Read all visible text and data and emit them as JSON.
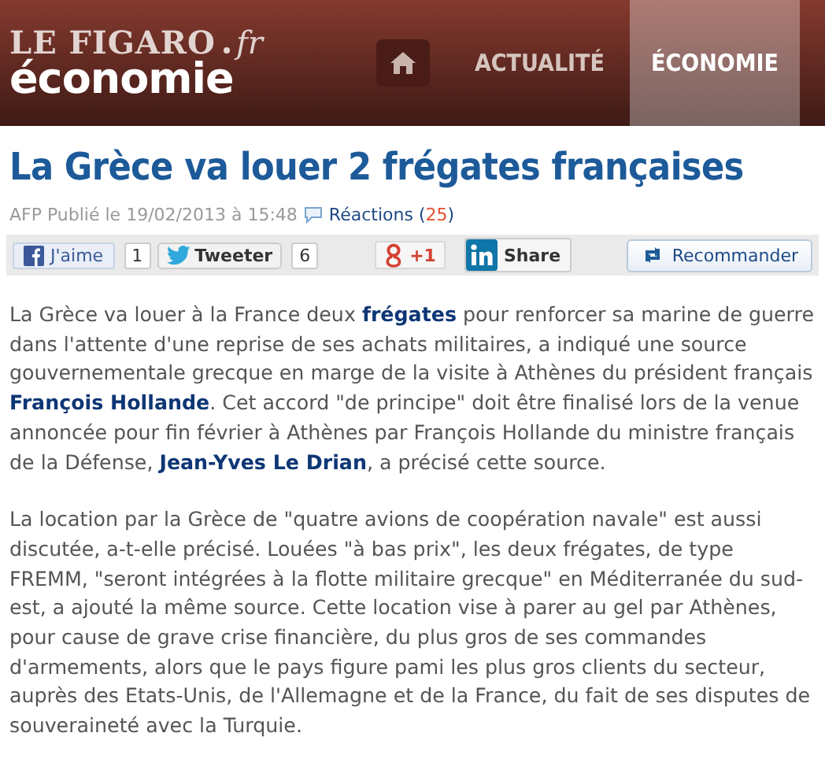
{
  "header": {
    "logo": {
      "brand": "LE FIGARO",
      "suffix": "fr",
      "section": "économie"
    },
    "nav": [
      {
        "kind": "home",
        "selected": false
      },
      {
        "kind": "text",
        "label": "ACTUALITÉ",
        "selected": false
      },
      {
        "kind": "text",
        "label": "ÉCONOMIE",
        "selected": true
      }
    ]
  },
  "article": {
    "title": "La Grèce va louer 2 frégates françaises",
    "meta": {
      "byline": "AFP Publié le 19/02/2013 à 15:48",
      "reactions_label": "Réactions",
      "reactions_open": "(",
      "reactions_count": "25",
      "reactions_close": ")"
    },
    "share": [
      {
        "kind": "facebook",
        "label": "J'aime",
        "count": "1"
      },
      {
        "kind": "twitter",
        "label": "Tweeter",
        "count": "6"
      },
      {
        "kind": "google",
        "label": "+1"
      },
      {
        "kind": "linkedin",
        "label": "Share"
      },
      {
        "kind": "recommend",
        "label": "Recommander"
      }
    ],
    "paragraphs": [
      "La Grèce va louer à la France deux **frégates** pour renforcer sa marine de guerre dans l'attente d'une reprise de ses achats militaires, a indiqué une source gouvernementale grecque en marge de la visite à Athènes du président français **François Hollande**.  Cet accord \"de principe\" doit être finalisé lors de la venue annoncée pour fin février à Athènes par François Hollande du ministre français de la Défense, **Jean-Yves Le Drian**, a précisé cette source.",
      "La location par la Grèce de \"quatre avions de coopération navale\" est aussi discutée, a-t-elle précisé.  Louées \"à bas prix\", les deux frégates, de type FREMM, \"seront intégrées à la flotte militaire grecque\" en Méditerranée du sud-est, a ajouté la même source.  Cette location vise à parer au gel par Athènes, pour cause de grave crise financière, du plus gros de ses commandes d'armements, alors que le pays figure pami les plus gros clients du secteur, auprès des Etats-Unis, de l'Allemagne et de la France, du fait de ses disputes de souveraineté avec la Turquie."
    ]
  }
}
